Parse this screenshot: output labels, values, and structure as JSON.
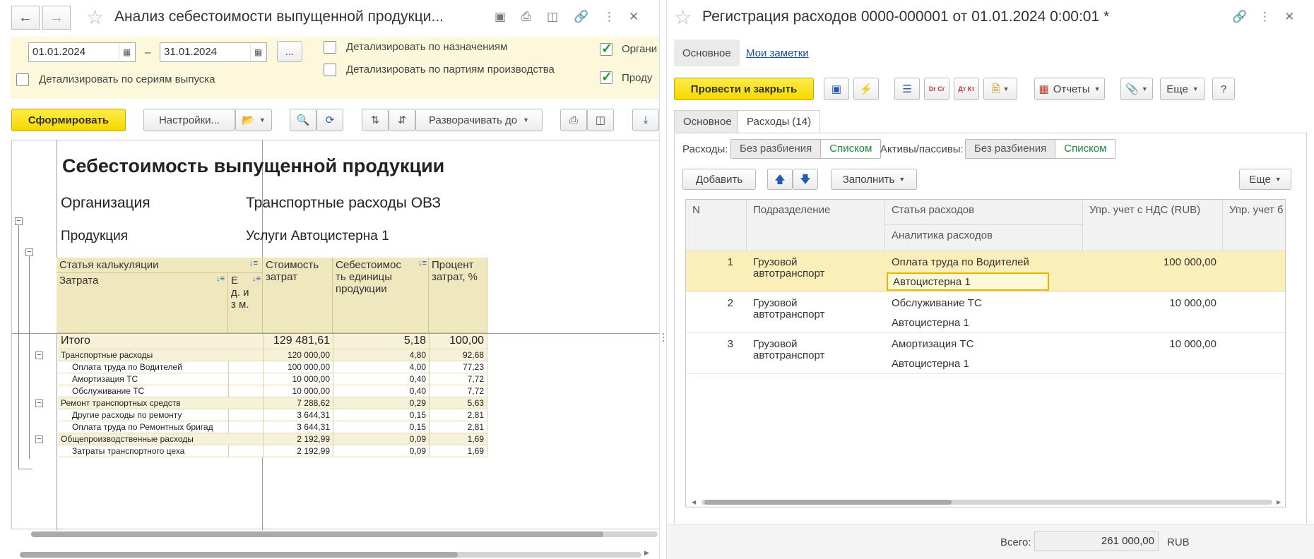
{
  "left": {
    "title": "Анализ себестоимости выпущенной продукци...",
    "filters": {
      "date_from": "01.01.2024",
      "date_dash": "–",
      "date_to": "31.01.2024",
      "more_label": "...",
      "detail_by_series": "Детализировать по сериям выпуска",
      "detail_by_purpose": "Детализировать по назначениям",
      "detail_by_batches": "Детализировать по партиям производства",
      "org_cut": "Органи",
      "prod_cut": "Проду"
    },
    "toolbar": {
      "form_label": "Сформировать",
      "settings_label": "Настройки...",
      "expand_label": "Разворачивать до"
    },
    "report": {
      "title": "Себестоимость выпущенной продукции",
      "org_label": "Организация",
      "org_value": "Транспортные расходы ОВЗ",
      "prod_label": "Продукция",
      "prod_value": "Услуги Автоцистерна 1",
      "headers": {
        "article": "Статья калькуляции",
        "cost_item": "Затрата",
        "unit": "Е д. из м.",
        "cost": "Стоимость затрат",
        "unit_cost": "Себестоимос ть единицы продукции",
        "percent": "Процент затрат, %"
      },
      "total": {
        "label": "Итого",
        "cost": "129 481,61",
        "unit": "5,18",
        "pct": "100,00"
      },
      "rows": [
        {
          "label": "Транспортные  расходы",
          "cost": "120 000,00",
          "unit": "4,80",
          "pct": "92,68",
          "group": true
        },
        {
          "label": "Оплата труда по Водителей",
          "cost": "100 000,00",
          "unit": "4,00",
          "pct": "77,23",
          "group": false
        },
        {
          "label": "Амортизация ТС",
          "cost": "10 000,00",
          "unit": "0,40",
          "pct": "7,72",
          "group": false
        },
        {
          "label": "Обслуживание ТС",
          "cost": "10 000,00",
          "unit": "0,40",
          "pct": "7,72",
          "group": false
        },
        {
          "label": "Ремонт транспортных средств",
          "cost": "7 288,62",
          "unit": "0,29",
          "pct": "5,63",
          "group": true
        },
        {
          "label": "Другие расходы по  ремонту",
          "cost": "3 644,31",
          "unit": "0,15",
          "pct": "2,81",
          "group": false
        },
        {
          "label": "Оплата труда по Ремонтных бригад",
          "cost": "3 644,31",
          "unit": "0,15",
          "pct": "2,81",
          "group": false
        },
        {
          "label": "Общепроизводственные расходы",
          "cost": "2 192,99",
          "unit": "0,09",
          "pct": "1,69",
          "group": true
        },
        {
          "label": "Затраты  транспортного цеха",
          "cost": "2 192,99",
          "unit": "0,09",
          "pct": "1,69",
          "group": false
        }
      ]
    }
  },
  "right": {
    "title": "Регистрация расходов 0000-000001 от 01.01.2024 0:00:01 *",
    "tabs": {
      "main": "Основное",
      "notes": "Мои заметки"
    },
    "toolbar": {
      "post_close": "Провести и закрыть",
      "reports": "Отчеты",
      "more": "Еще",
      "help": "?",
      "dr_cr": "Dr Cr",
      "dt_kt": "Дт Кт"
    },
    "subtabs": {
      "main": "Основное",
      "expenses": "Расходы (14)"
    },
    "expenses_mode": {
      "label": "Расходы:",
      "opt1": "Без разбиения",
      "opt2": "Списком"
    },
    "assets_mode": {
      "label": "Активы/пассивы:",
      "opt1": "Без разбиения",
      "opt2": "Списком"
    },
    "table_toolbar": {
      "add": "Добавить",
      "fill": "Заполнить",
      "more": "Еще"
    },
    "columns": {
      "n": "N",
      "dept": "Подразделение",
      "article": "Статья расходов",
      "analytics": "Аналитика расходов",
      "amount": "Упр. учет с НДС (RUB)",
      "amount2": "Упр. учет б"
    },
    "rows": [
      {
        "n": "1",
        "dept1": "Грузовой",
        "dept2": "автотранспорт",
        "article": "Оплата труда по Водителей",
        "analytics": "Автоцистерна 1",
        "amount": "100 000,00"
      },
      {
        "n": "2",
        "dept1": "Грузовой",
        "dept2": "автотранспорт",
        "article": "Обслуживание ТС",
        "analytics": "Автоцистерна 1",
        "amount": "10 000,00"
      },
      {
        "n": "3",
        "dept1": "Грузовой",
        "dept2": "автотранспорт",
        "article": "Амортизация ТС",
        "analytics": "Автоцистерна 1",
        "amount": "10 000,00"
      }
    ],
    "total": {
      "label": "Всего:",
      "value": "261 000,00",
      "currency": "RUB"
    }
  }
}
